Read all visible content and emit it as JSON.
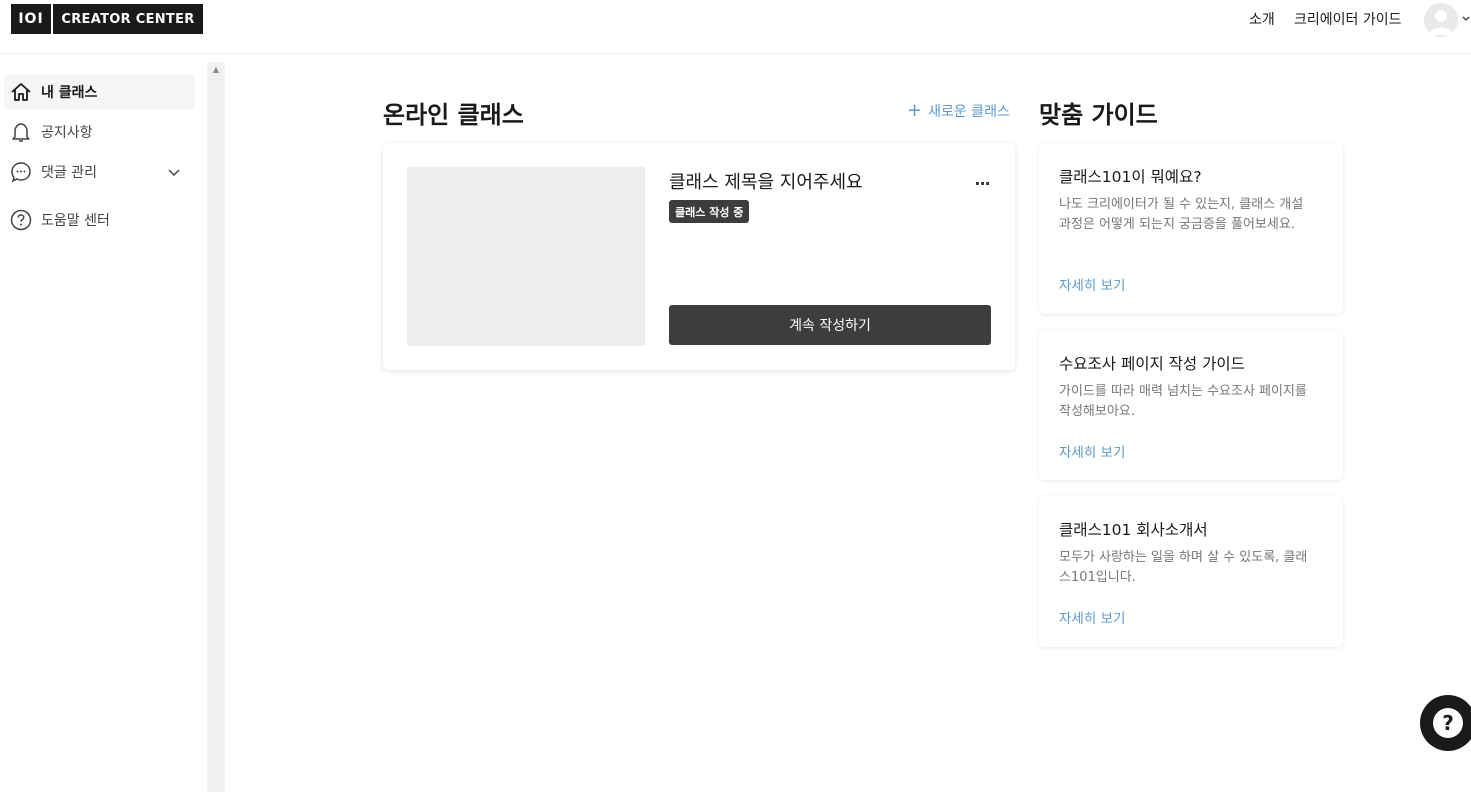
{
  "header": {
    "logo_mark": "IOI",
    "logo_text": "CREATOR CENTER",
    "nav_about": "소개",
    "nav_creator_guide": "크리에이터 가이드",
    "avatar_icon": "user-avatar-icon",
    "menu_icon": "chevron-down-icon"
  },
  "sidebar": {
    "items": [
      {
        "label": "내 클래스",
        "icon": "home-icon",
        "active": true
      },
      {
        "label": "공지사항",
        "icon": "bell-icon",
        "active": false
      },
      {
        "label": "댓글 관리",
        "icon": "comment-icon",
        "active": false,
        "has_submenu": true
      },
      {
        "label": "도움말 센터",
        "icon": "help-circle-icon",
        "active": false
      }
    ]
  },
  "main": {
    "title": "온라인 클래스",
    "new_class_label": "새로운 클래스",
    "classes": [
      {
        "title": "클래스 제목을 지어주세요",
        "status_badge": "클래스 작성 중",
        "more_label": "...",
        "continue_label": "계속 작성하기"
      }
    ]
  },
  "guides": {
    "title": "맞춤 가이드",
    "items": [
      {
        "title": "클래스101이 뭐예요?",
        "description": "나도 크리에이터가 될 수 있는지, 클래스 개설 과정은 어떻게 되는지 궁금증을 풀어보세요.",
        "link": "자세히 보기"
      },
      {
        "title": "수요조사 페이지 작성 가이드",
        "description": "가이드를 따라 매력 넘치는 수요조사 페이지를 작성해보아요.",
        "link": "자세히 보기"
      },
      {
        "title": "클래스101 회사소개서",
        "description": "모두가 사랑하는 일을 하며 살 수 있도록, 클래스101입니다.",
        "link": "자세히 보기"
      }
    ]
  },
  "help_fab": {
    "label": "?"
  },
  "colors": {
    "accent": "#5b9bd0",
    "dark": "#1a1a1a",
    "button": "#3d3d3d"
  }
}
